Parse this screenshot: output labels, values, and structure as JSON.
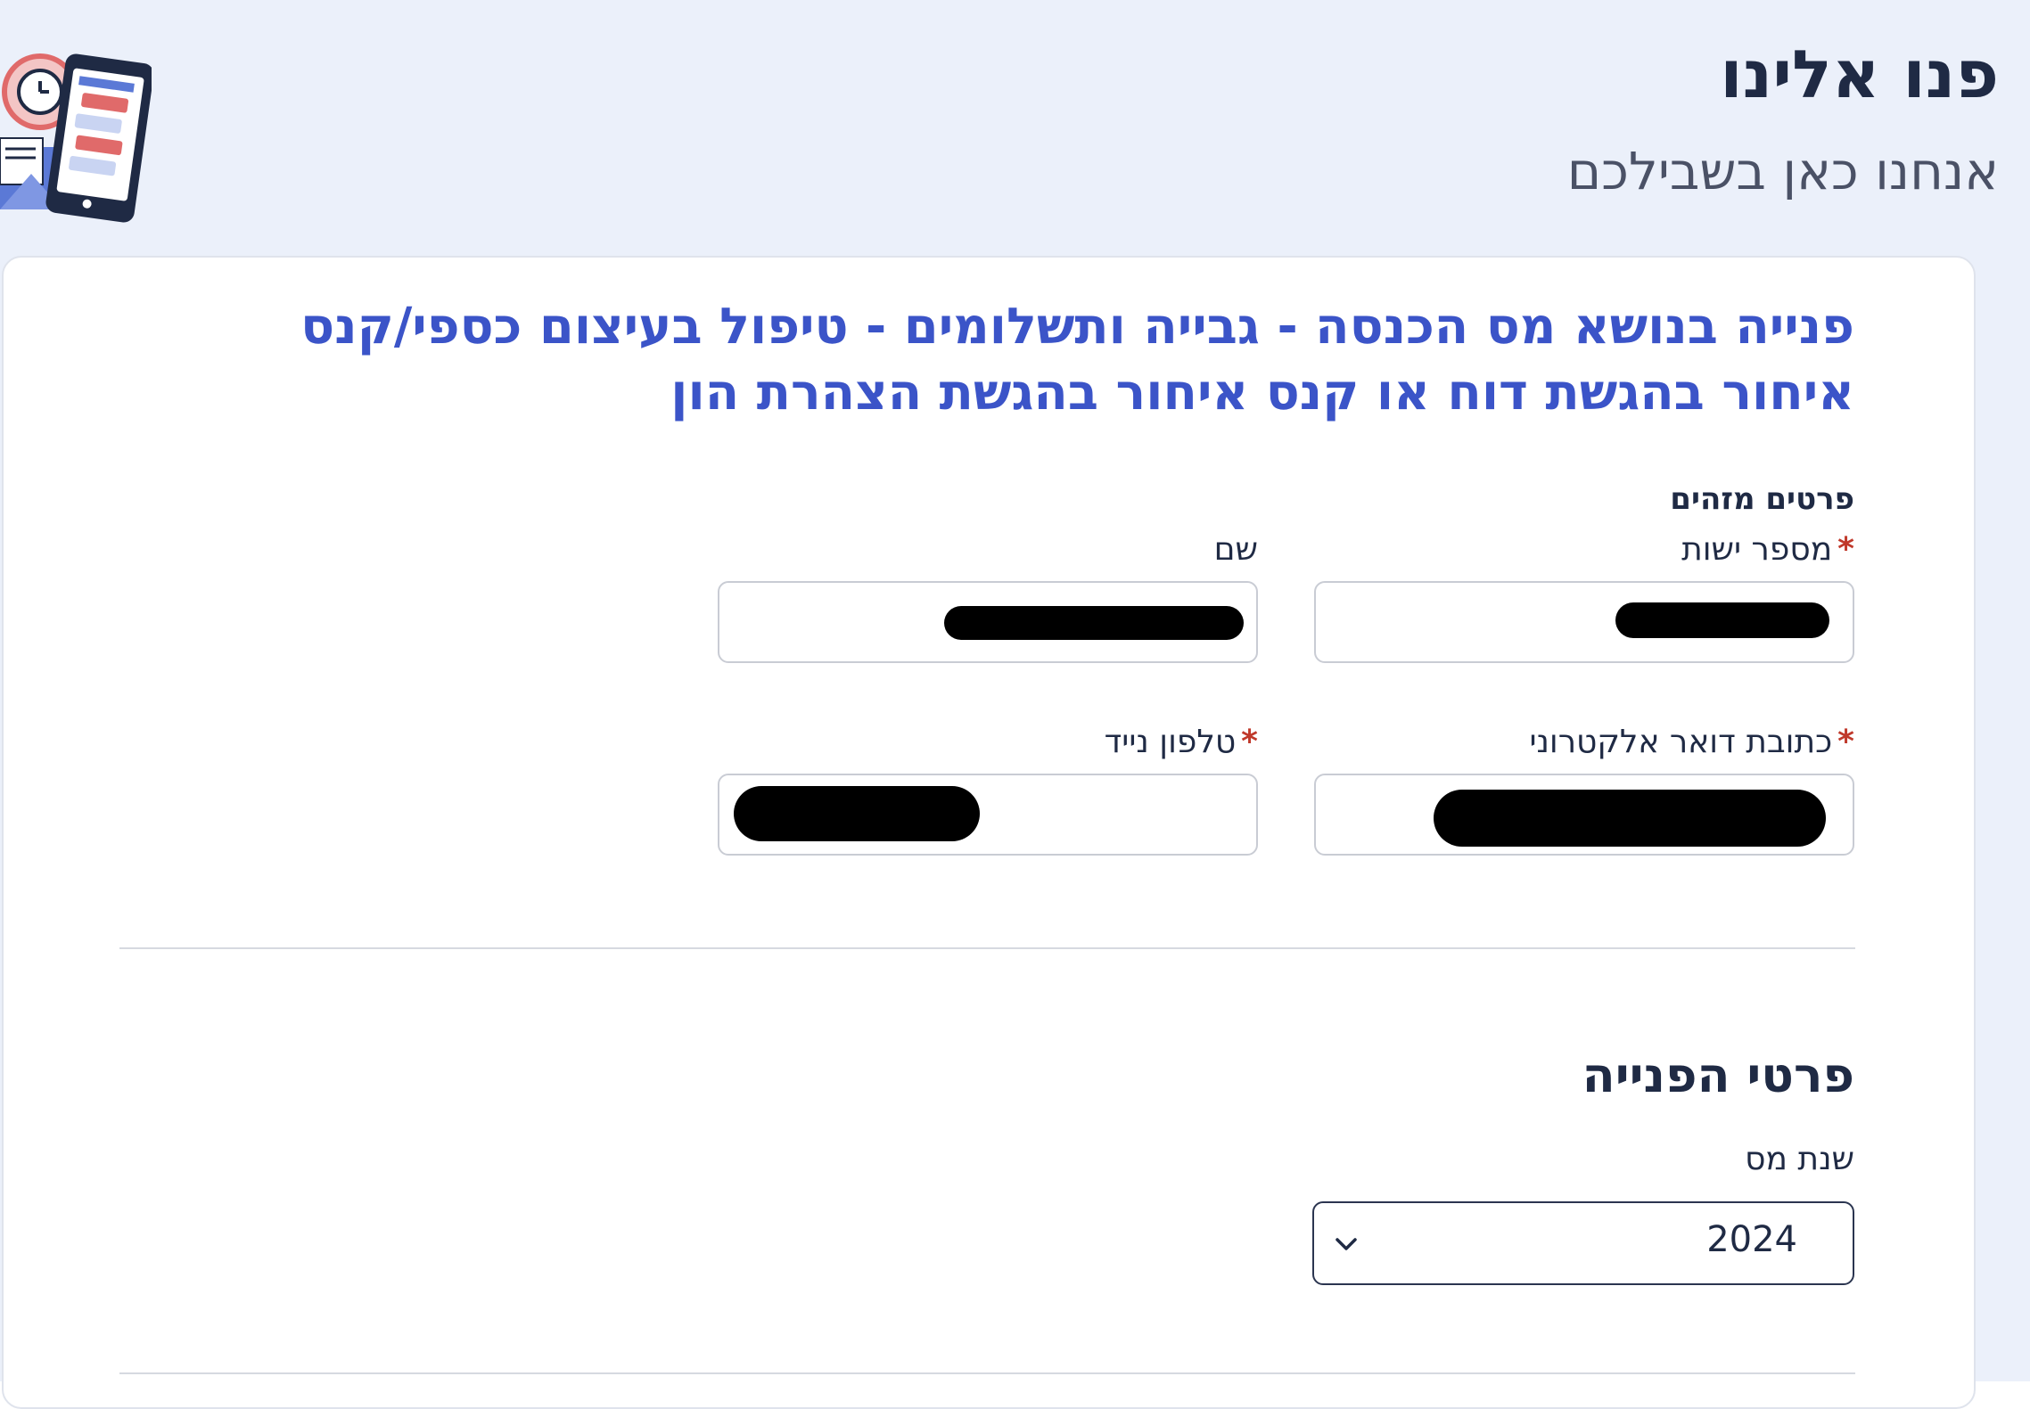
{
  "header": {
    "title": "פנו אלינו",
    "subtitle": "אנחנו כאן בשבילכם",
    "illustration_icon": "contact-phone-mail-illustration"
  },
  "form": {
    "heading": "פנייה בנושא מס הכנסה - גבייה ותשלומים - טיפול בעיצום כספי/קנס איחור בהגשת דוח או קנס איחור בהגשת הצהרת הון",
    "identifying_section_label": "פרטים מזהים",
    "fields": {
      "id_number": {
        "label": "מספר ישות",
        "required": true,
        "value_redacted": true
      },
      "name": {
        "label": "שם",
        "required": false,
        "value_redacted": true
      },
      "email": {
        "label": "כתובת דואר אלקטרוני",
        "required": true,
        "value_redacted": true
      },
      "mobile": {
        "label": "טלפון נייד",
        "required": true,
        "value_redacted": true
      }
    },
    "required_marker": "*",
    "request_section_title": "פרטי הפנייה",
    "tax_year": {
      "label": "שנת מס",
      "selected": "2024",
      "chevron_icon": "chevron-down-icon"
    }
  },
  "colors": {
    "page_background": "#ebf0fa",
    "heading_blue": "#3b54c8",
    "text_dark": "#1f2a44",
    "required_red": "#c0392b"
  }
}
